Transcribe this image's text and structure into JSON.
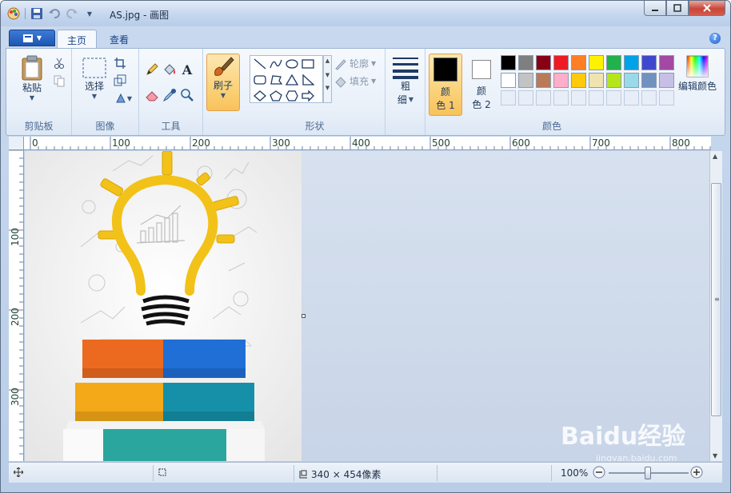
{
  "window": {
    "title": "AS.jpg - 画图"
  },
  "tabs": [
    {
      "label": "主页",
      "active": true
    },
    {
      "label": "查看",
      "active": false
    }
  ],
  "groups": {
    "clipboard": {
      "label": "剪贴板",
      "paste": "粘贴"
    },
    "image": {
      "label": "图像",
      "select": "选择"
    },
    "tools": {
      "label": "工具",
      "text_glyph": "A"
    },
    "brush": {
      "label": "刷子"
    },
    "shapes": {
      "label": "形状",
      "outline": "轮廓",
      "fill": "填充"
    },
    "size": {
      "label_line1": "粗",
      "label_line2": "细"
    },
    "colors": {
      "label": "颜色",
      "color1_line1": "颜",
      "color1_line2": "色 1",
      "color2_line1": "颜",
      "color2_line2": "色 2",
      "edit": "编辑颜色",
      "color1_value": "#000000",
      "color2_value": "#ffffff",
      "palette": [
        "#000000",
        "#7f7f7f",
        "#880015",
        "#ed1c24",
        "#ff7f27",
        "#fff200",
        "#22b14c",
        "#00a2e8",
        "#3f48cc",
        "#a349a4",
        "#ffffff",
        "#c3c3c3",
        "#b97a57",
        "#ffaec9",
        "#ffc90e",
        "#efe4b0",
        "#b5e61d",
        "#99d9ea",
        "#7092be",
        "#c8bfe7"
      ]
    }
  },
  "ruler": {
    "h_marks": [
      "0",
      "100",
      "200",
      "300",
      "400",
      "500",
      "600",
      "700",
      "800"
    ],
    "v_marks": [
      "100",
      "200",
      "300"
    ]
  },
  "status": {
    "size_text": "340 × 454像素",
    "zoom": "100%"
  },
  "watermark": {
    "text": "Baidu经验",
    "sub": "jingyan.baidu.com"
  }
}
